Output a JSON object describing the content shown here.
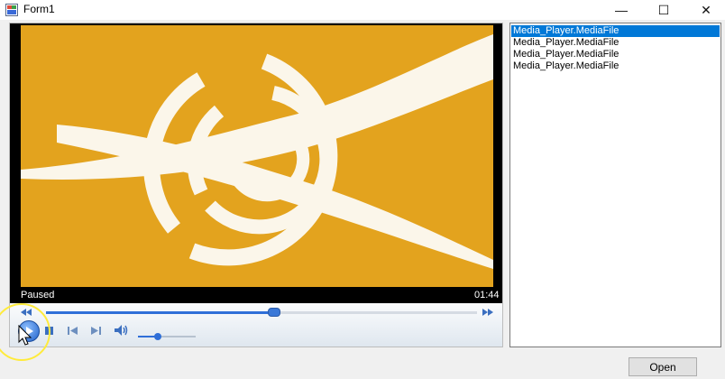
{
  "window": {
    "title": "Form1",
    "minimize_glyph": "—",
    "maximize_glyph": "☐",
    "close_glyph": "✕"
  },
  "player": {
    "status_text": "Paused",
    "time_text": "01:44",
    "seek_progress": 0.53,
    "volume_level": 0.35,
    "icons": {
      "rewind": "rewind-icon",
      "fast_forward": "fast-forward-icon",
      "play": "play-icon",
      "stop": "stop-icon",
      "previous": "previous-icon",
      "next": "next-icon",
      "volume": "volume-icon"
    }
  },
  "playlist": {
    "items": [
      {
        "label": "Media_Player.MediaFile",
        "selected": true
      },
      {
        "label": "Media_Player.MediaFile",
        "selected": false
      },
      {
        "label": "Media_Player.MediaFile",
        "selected": false
      },
      {
        "label": "Media_Player.MediaFile",
        "selected": false
      }
    ]
  },
  "buttons": {
    "open_label": "Open"
  },
  "colors": {
    "video_background": "#e3a31e",
    "selection": "#0078d7",
    "accent": "#2f6fd8"
  }
}
